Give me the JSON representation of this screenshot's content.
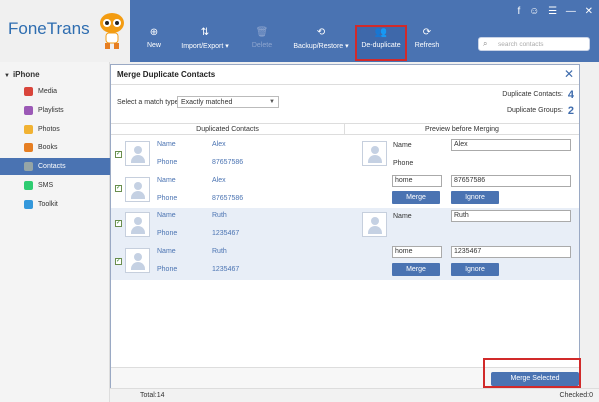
{
  "app": {
    "name": "FoneTrans"
  },
  "toolbar": {
    "buttons": [
      {
        "label": "New",
        "icon": "plus-icon"
      },
      {
        "label": "Import/Export",
        "icon": "import-export-icon"
      },
      {
        "label": "Delete",
        "icon": "trash-icon"
      },
      {
        "label": "Backup/Restore",
        "icon": "backup-icon"
      },
      {
        "label": "De-duplicate",
        "icon": "dedupe-icon"
      },
      {
        "label": "Refresh",
        "icon": "refresh-icon"
      }
    ],
    "search_placeholder": "search contacts"
  },
  "sidebar": {
    "device": "iPhone",
    "items": [
      {
        "label": "Media",
        "color": "#d9453b"
      },
      {
        "label": "Playlists",
        "color": "#9b59b6"
      },
      {
        "label": "Photos",
        "color": "#f1b232"
      },
      {
        "label": "Books",
        "color": "#e67e22"
      },
      {
        "label": "Contacts",
        "color": "#7f8c8d"
      },
      {
        "label": "SMS",
        "color": "#2ecc71"
      },
      {
        "label": "Toolkit",
        "color": "#3498db"
      }
    ]
  },
  "dialog": {
    "title": "Merge Duplicate Contacts",
    "match_label": "Select a match type:",
    "match_value": "Exactly matched",
    "dup_contacts_label": "Duplicate Contacts:",
    "dup_contacts_value": "4",
    "dup_groups_label": "Duplicate Groups:",
    "dup_groups_value": "2",
    "col_left": "Duplicated Contacts",
    "col_right": "Preview before Merging",
    "name_label": "Name",
    "phone_label": "Phone",
    "contacts": [
      {
        "name": "Alex",
        "phone": "87657586"
      },
      {
        "name": "Alex",
        "phone": "87657586"
      },
      {
        "name": "Ruth",
        "phone": "1235467"
      },
      {
        "name": "Ruth",
        "phone": "1235467"
      }
    ],
    "previews": [
      {
        "name": "Alex",
        "phone_type": "home",
        "phone": "87657586"
      },
      {
        "name": "Ruth",
        "phone_type": "home",
        "phone": "1235467"
      }
    ],
    "merge_label": "Merge",
    "ignore_label": "Ignore",
    "merge_selected_label": "Merge Selected"
  },
  "status": {
    "total": "Total:14",
    "checked": "Checked:0"
  }
}
